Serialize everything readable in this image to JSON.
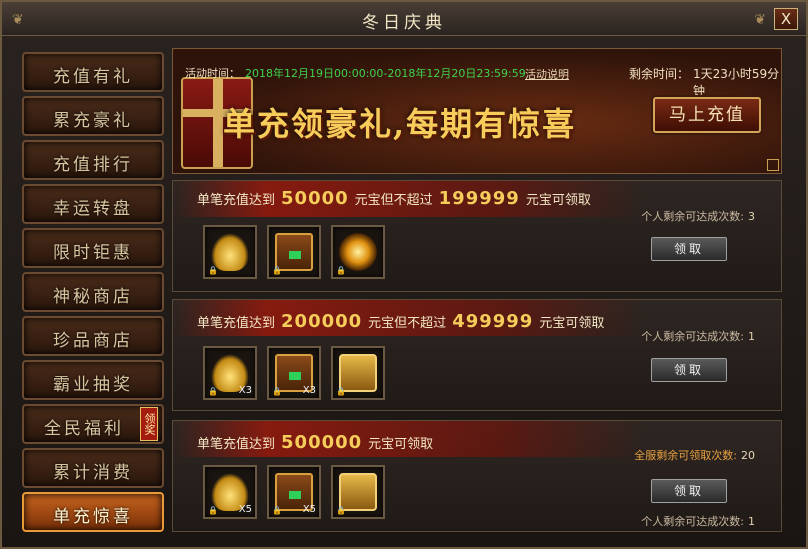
{
  "window": {
    "title": "冬日庆典",
    "close": "X"
  },
  "sidebar": {
    "items": [
      {
        "label": "充值有礼"
      },
      {
        "label": "累充豪礼"
      },
      {
        "label": "充值排行"
      },
      {
        "label": "幸运转盘"
      },
      {
        "label": "限时钜惠"
      },
      {
        "label": "神秘商店"
      },
      {
        "label": "珍品商店"
      },
      {
        "label": "霸业抽奖"
      },
      {
        "label": "全民福利",
        "badge": "领奖"
      },
      {
        "label": "累计消费"
      },
      {
        "label": "单充惊喜",
        "active": true
      }
    ]
  },
  "banner": {
    "activity_label": "活动时间：",
    "activity_time": "2018年12月19日00:00:00-2018年12月20日23:59:59",
    "activity_link": "活动说明",
    "remain_label": "剩余时间：",
    "remain_value": "1天23小时59分钟",
    "slogan": "单充领豪礼,每期有惊喜",
    "recharge_button": "马上充值"
  },
  "rewards": [
    {
      "prefix": "单笔充值达到",
      "amount": "50000",
      "mid": "元宝但不超过",
      "max": "199999",
      "suffix": "元宝可领取",
      "items": [
        {
          "icon": "gold-ingot-icon",
          "qty": ""
        },
        {
          "icon": "treasure-chest-icon",
          "qty": ""
        },
        {
          "icon": "golden-orb-icon",
          "qty": ""
        }
      ],
      "personal_label": "个人剩余可达成次数:",
      "personal_count": "3",
      "claim": "领取"
    },
    {
      "prefix": "单笔充值达到",
      "amount": "200000",
      "mid": "元宝但不超过",
      "max": "499999",
      "suffix": "元宝可领取",
      "items": [
        {
          "icon": "gold-ingot-icon",
          "qty": "X3"
        },
        {
          "icon": "treasure-chest-icon",
          "qty": "X3"
        },
        {
          "icon": "gold-chest-icon",
          "qty": ""
        }
      ],
      "personal_label": "个人剩余可达成次数:",
      "personal_count": "1",
      "claim": "领取"
    },
    {
      "prefix": "单笔充值达到",
      "amount": "500000",
      "suffix": "元宝可领取",
      "items": [
        {
          "icon": "gold-ingot-icon",
          "qty": "X5"
        },
        {
          "icon": "treasure-chest-icon",
          "qty": "X5"
        },
        {
          "icon": "gold-chest-icon",
          "qty": ""
        }
      ],
      "server_label": "全服剩余可领取次数:",
      "server_count": "20",
      "personal_label": "个人剩余可达成次数:",
      "personal_count": "1",
      "claim": "领取"
    }
  ]
}
